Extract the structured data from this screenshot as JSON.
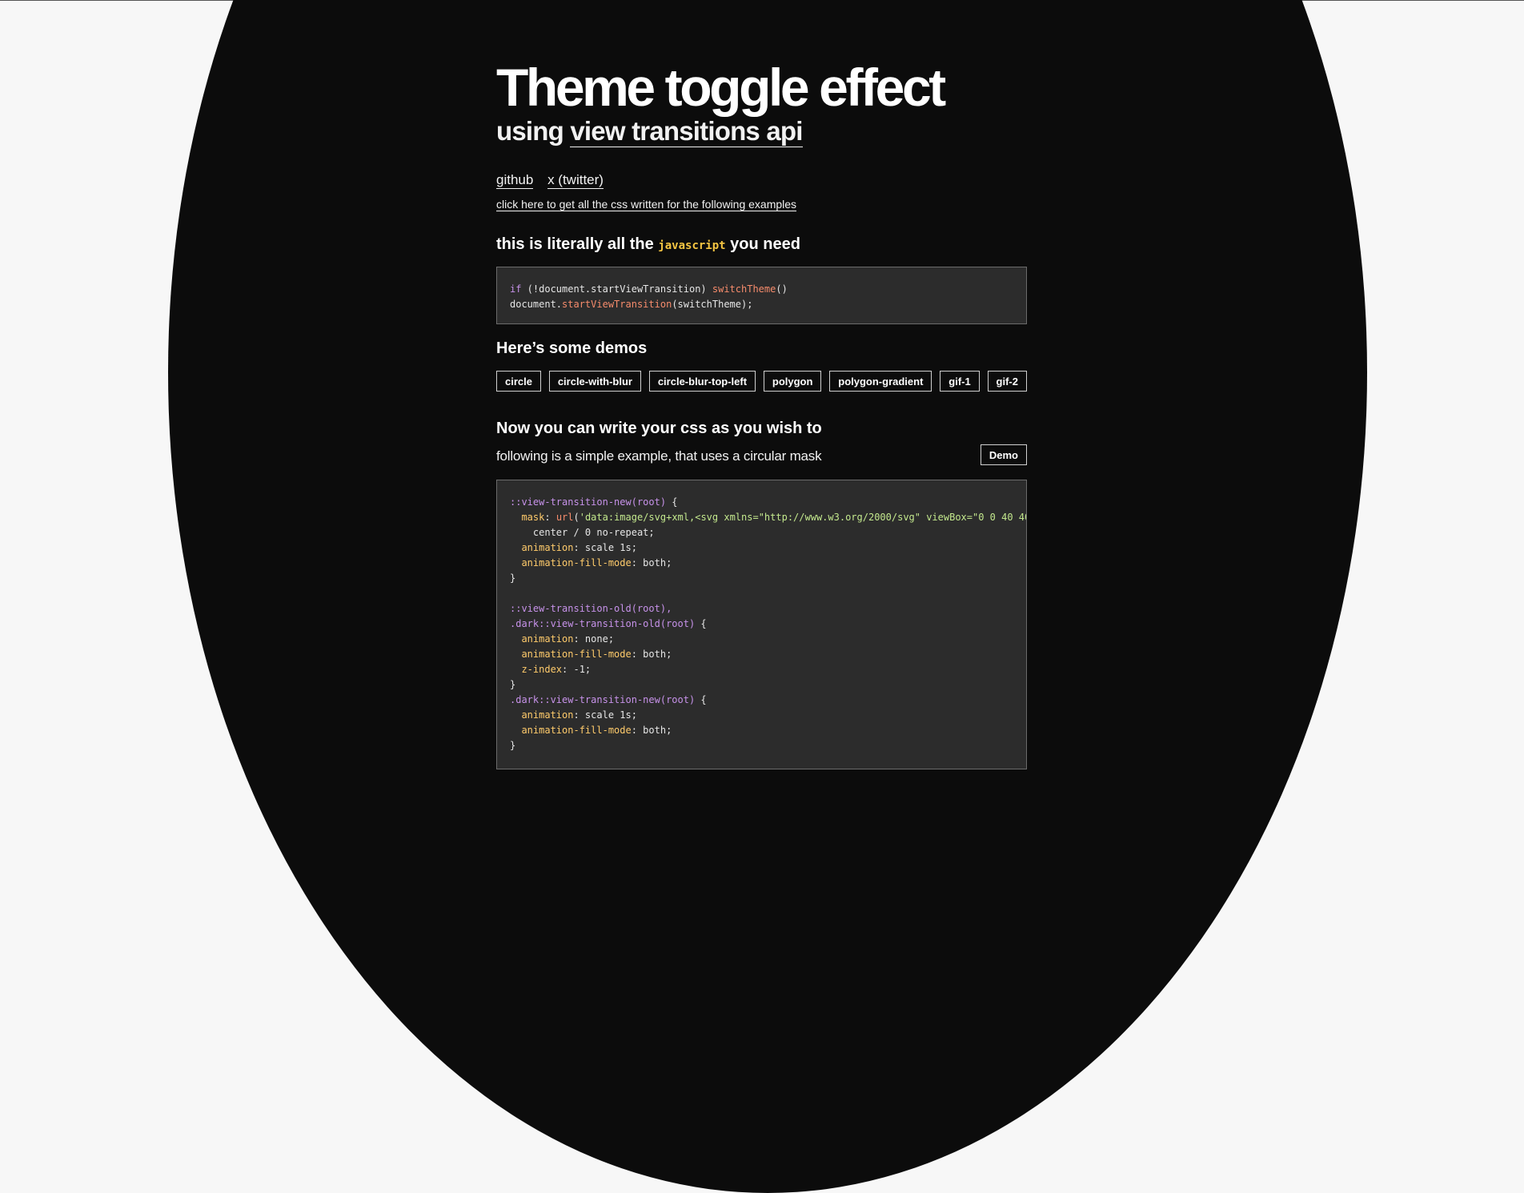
{
  "title": "Theme toggle effect",
  "subtitle": {
    "prefix": "using ",
    "link": "view transitions api"
  },
  "links": [
    "github",
    "x (twitter)"
  ],
  "css_link": "click here to get all the css written for the following examples",
  "js_heading": {
    "prefix": "this is literally all the ",
    "code": "javascript",
    "suffix": " you need"
  },
  "demos_heading": "Here’s some demos",
  "demos": [
    "circle",
    "circle-with-blur",
    "circle-blur-top-left",
    "polygon",
    "polygon-gradient",
    "gif-1",
    "gif-2"
  ],
  "css_heading": "Now you can write your css as you wish to",
  "css_desc": "following is a simple example, that uses a circular mask",
  "demo_button": "Demo"
}
